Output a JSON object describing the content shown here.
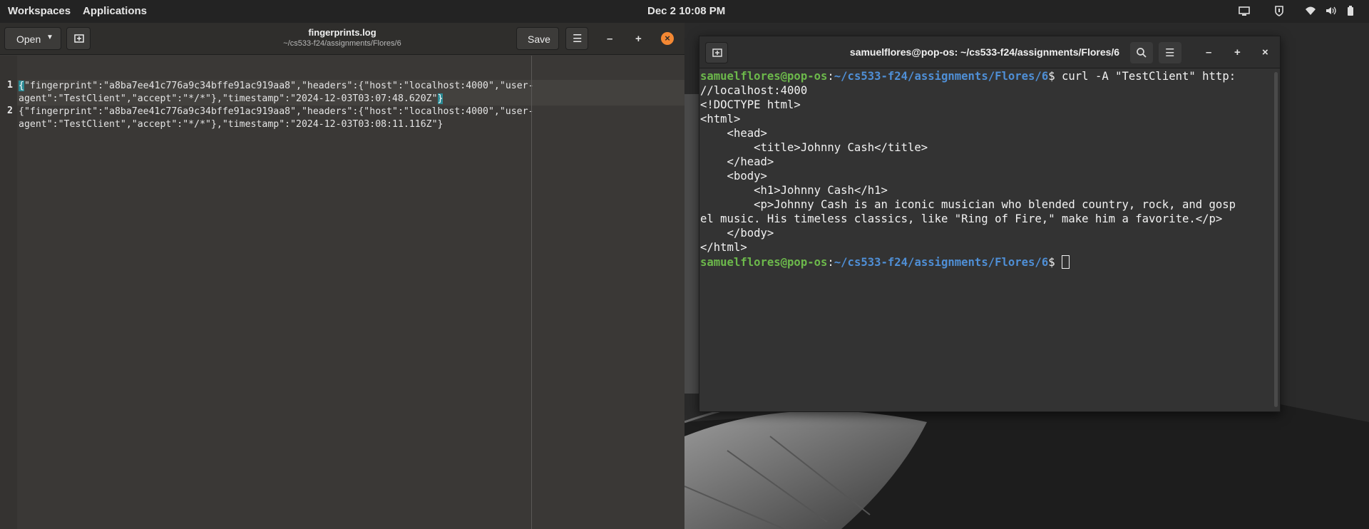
{
  "topbar": {
    "workspaces": "Workspaces",
    "applications": "Applications",
    "clock": "Dec 2  10:08 PM",
    "tray_icons": [
      "display-icon",
      "vpn-icon",
      "wifi-icon",
      "volume-icon",
      "battery-icon"
    ]
  },
  "gedit": {
    "open_label": "Open",
    "title": "fingerprints.log",
    "subtitle": "~/cs533-f24/assignments/Flores/6",
    "save_label": "Save",
    "minimize": "–",
    "maximize": "+",
    "close": "×",
    "line_numbers": [
      "1",
      "2"
    ],
    "lines": [
      {
        "row1_open": "{",
        "row1_mid": "\"fingerprint\":\"a8ba7ee41c776a9c34bffe91ac919aa8\",\"headers\":{\"host\":\"localhost:4000\",\"user-",
        "row2": "agent\":\"TestClient\",\"accept\":\"*/*\"},\"timestamp\":\"2024-12-03T03:07:48.620Z\"",
        "row2_close": "}"
      },
      {
        "row1": "{\"fingerprint\":\"a8ba7ee41c776a9c34bffe91ac919aa8\",\"headers\":{\"host\":\"localhost:4000\",\"user-",
        "row2": "agent\":\"TestClient\",\"accept\":\"*/*\"},\"timestamp\":\"2024-12-03T03:08:11.116Z\"}"
      }
    ]
  },
  "terminal": {
    "title": "samuelflores@pop-os: ~/cs533-f24/assignments/Flores/6",
    "prompt_user": "samuelflores@pop-os",
    "prompt_sep": ":",
    "prompt_path": "~/cs533-f24/assignments/Flores/6",
    "prompt_dollar": "$ ",
    "command": "curl -A \"TestClient\" http:",
    "output": [
      "//localhost:4000",
      "<!DOCTYPE html>",
      "<html>",
      "    <head>",
      "        <title>Johnny Cash</title>",
      "    </head>",
      "    <body>",
      "        <h1>Johnny Cash</h1>",
      "        <p>Johnny Cash is an iconic musician who blended country, rock, and gosp",
      "el music. His timeless classics, like \"Ring of Fire,\" make him a favorite.</p>",
      "    </body>",
      "</html>"
    ],
    "minimize": "–",
    "maximize": "+",
    "close": "×"
  }
}
